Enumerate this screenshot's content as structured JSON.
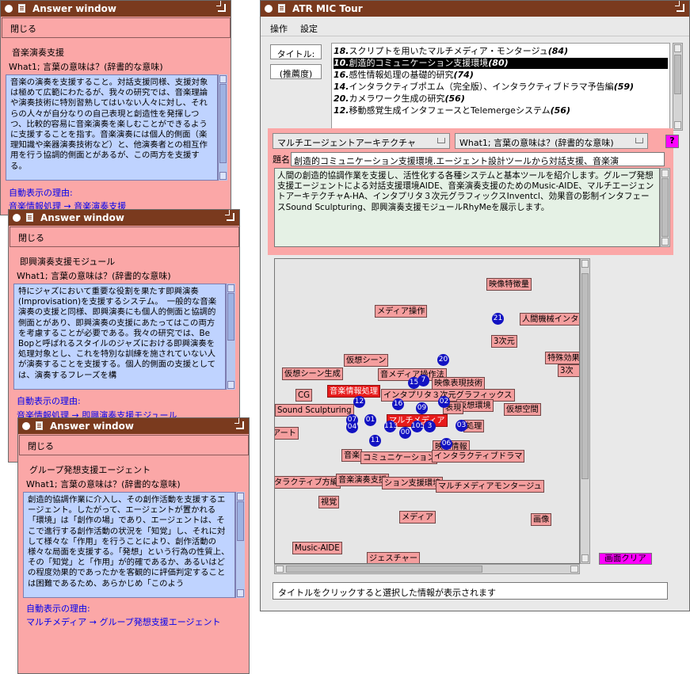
{
  "answer_windows": [
    {
      "title": "Answer window",
      "close_label": "閉じる",
      "item_title": "音楽演奏支援",
      "question": "What1; 言葉の意味は？(辞書的な意味)",
      "text": "音楽の演奏を支援すること。対話支援同様、支援対象は極めて広範にわたるが、我々の研究では、音楽理論や演奏技術に特別習熟してはいない人々に対し、それらの人々が自分なりの自己表現と創造性を発揮しつつ、比較的容易に音楽演奏を楽しむことができるように支援することを指す。音楽演奏には個人的側面（楽理知識や楽器演奏技術など）と、他演奏者との相互作用を行う協調的側面とがあるが、この両方を支援する。",
      "reason_label": "自動表示の理由:",
      "reason_path": "音楽情報処理 → 音楽演奏支援"
    },
    {
      "title": "Answer window",
      "close_label": "閉じる",
      "item_title": "即興演奏支援モジュール",
      "question": "What1; 言葉の意味は？(辞書的な意味)",
      "text": "特にジャズにおいて重要な役割を果たす即興演奏(Improvisation)を支援するシステム。　一般的な音楽演奏の支援と同様、即興演奏にも個人的側面と協調的側面とがあり、即興演奏の支援にあたってはこの両方を考慮することが必要である。我々の研究では、Be Bopと呼ばれるスタイルのジャズにおける即興演奏を処理対象とし、これを特別な訓練を施されていない人が演奏することを支援する。個人的側面の支援としては、演奏するフレーズを構",
      "reason_label": "自動表示の理由:",
      "reason_path": "音楽情報処理 → 即興演奏支援モジュール"
    },
    {
      "title": "Answer window",
      "close_label": "閉じる",
      "item_title": "グループ発想支援エージェント",
      "question": "What1; 言葉の意味は？(辞書的な意味)",
      "text": "創造的協調作業に介入し、その創作活動を支援するエージェント。したがって、エージェントが置かれる「環境」は「創作の場」であり、エージェントは、そこで進行する創作活動の状況を「知覚」し、それに対して様々な「作用」を行うことにより、創作活動の様々な局面を支援する。「発想」という行為の性質上、その「知覚」と「作用」が的確であるか、あるいはどの程度効果的であったかを客観的に評価判定することは困難であるため、あらかじめ「このよう",
      "reason_label": "自動表示の理由:",
      "reason_path": "マルチメディア → グループ発想支援エージェント"
    }
  ],
  "main": {
    "title": "ATR MIC Tour",
    "menu": [
      "操作",
      "設定"
    ],
    "title_label": "タイトル:",
    "recommend_label": "(推薦度)",
    "titles": [
      {
        "num": "18.",
        "text": "スクリプトを用いたマルチメディア・モンタージュ",
        "score": "(84)",
        "selected": false
      },
      {
        "num": "10.",
        "text": "創造的コミュニケーション支援環境",
        "score": "(80)",
        "selected": true
      },
      {
        "num": "16.",
        "text": "感性情報処理の基礎的研究",
        "score": "(74)",
        "selected": false
      },
      {
        "num": "14.",
        "text": "インタラクティブポエム（完全版）、インタラクティブドラマ予告編",
        "score": "(59)",
        "selected": false
      },
      {
        "num": "20.",
        "text": "カメラワーク生成の研究",
        "score": "(56)",
        "selected": false
      },
      {
        "num": "12.",
        "text": "移動感覚生成インタフェースとTelemergeシステム",
        "score": "(56)",
        "selected": false
      }
    ],
    "keyword_select": "マルチエージェントアーキテクチャ",
    "question_select": "What1; 言葉の意味は？(辞書的な意味)",
    "help_label": "?",
    "detail_label": "題名:",
    "detail_title": "創造的コミュニケーション支援環境.エージェント設計ツールから対話支援、音楽演",
    "description": "人間の創造的協調作業を支援し、活性化する各種システムと基本ツールを紹介します。グループ発想支援エージェントによる対話支援環境AIDE、音楽演奏支援のためのMusic-AIDE、マルチエージェントアーキテクチャA-HA、インタプリタ３次元グラフィックスInventcl、効果音の影制インタフェースSound Sculpturing、即興演奏支援モジュールRhyMeを展示します。",
    "graph_nodes": [
      {
        "label": "映像特徴量",
        "hl": false
      },
      {
        "label": "メディア操作",
        "hl": false
      },
      {
        "label": "人間機械インタ",
        "hl": false
      },
      {
        "label": "3次元",
        "hl": false
      },
      {
        "label": "特殊効果",
        "hl": false
      },
      {
        "label": "3次",
        "hl": false
      },
      {
        "label": "仮想シーン",
        "hl": false
      },
      {
        "label": "仮想シーン生成",
        "hl": false
      },
      {
        "label": "音メディア操作法",
        "hl": false
      },
      {
        "label": "映像表現技術",
        "hl": false
      },
      {
        "label": "音楽情報処理",
        "hl": true
      },
      {
        "label": "インタプリタ３次元グラフィックス",
        "hl": false
      },
      {
        "label": "CG",
        "hl": false
      },
      {
        "label": "仮想環境",
        "hl": false
      },
      {
        "label": "仮想空間",
        "hl": false
      },
      {
        "label": "Sound Sculpturing",
        "hl": false
      },
      {
        "label": "マルチメディア",
        "hl": true
      },
      {
        "label": "表現",
        "hl": false
      },
      {
        "label": "処理",
        "hl": false
      },
      {
        "label": "アート",
        "hl": false
      },
      {
        "label": "映像情報",
        "hl": false
      },
      {
        "label": "音楽",
        "hl": false
      },
      {
        "label": "コミュニケーション",
        "hl": false
      },
      {
        "label": "インタラクティブドラマ",
        "hl": false
      },
      {
        "label": "タラクティブ方編",
        "hl": false
      },
      {
        "label": "音楽演奏支援",
        "hl": false
      },
      {
        "label": "ション支援環境",
        "hl": false
      },
      {
        "label": "マルチメディアモンタージュ",
        "hl": false
      },
      {
        "label": "視覚",
        "hl": false
      },
      {
        "label": "メディア",
        "hl": false
      },
      {
        "label": "画像",
        "hl": false
      },
      {
        "label": "Music-AIDE",
        "hl": false
      },
      {
        "label": "ジェスチャー",
        "hl": false
      }
    ],
    "graph_dots": [
      "21",
      "20",
      "15",
      "7",
      "02",
      "12",
      "16",
      "09",
      "07",
      "01",
      "04",
      "03",
      "113",
      "105",
      "3",
      "00",
      "11",
      "06"
    ],
    "clear_label": "画面クリア",
    "status": "タイトルをクリックすると選択した情報が表示されます"
  },
  "colors": {
    "titlebar": "#7a3a1e",
    "answer_bg": "#fba7a7",
    "answer_text_bg": "#bfd3ff",
    "link": "#0000ee",
    "node_bg": "#f49e9e",
    "node_highlight": "#e71b1b",
    "dot": "#1212c2",
    "accent_magenta": "#ff00ff"
  }
}
